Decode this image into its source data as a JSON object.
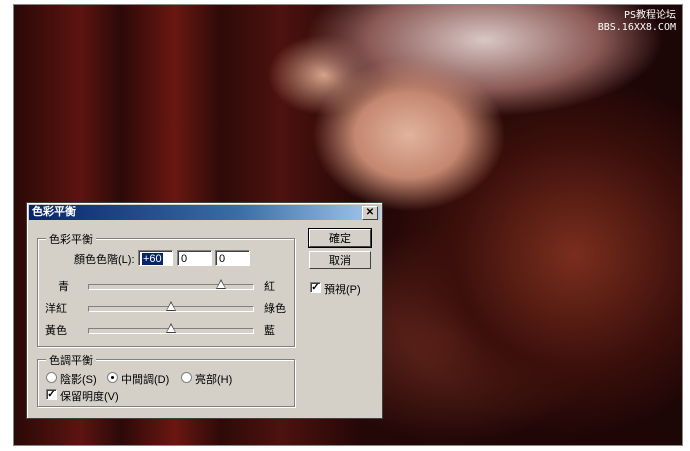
{
  "watermark": {
    "line1": "PS教程论坛",
    "line2": "BBS.16XX8.COM"
  },
  "dialog": {
    "title": "色彩平衡",
    "close_glyph": "✕",
    "color_balance": {
      "group_title": "色彩平衡",
      "levels_label": "顏色色階(L):",
      "levels": [
        "+60",
        "0",
        "0"
      ],
      "sliders": [
        {
          "left": "青",
          "right": "紅",
          "value": 60
        },
        {
          "left": "洋紅",
          "right": "綠色",
          "value": 0
        },
        {
          "left": "黃色",
          "right": "藍",
          "value": 0
        }
      ]
    },
    "tone_balance": {
      "group_title": "色調平衡",
      "options": [
        {
          "label": "陰影(S)",
          "checked": false
        },
        {
          "label": "中間調(D)",
          "checked": true
        },
        {
          "label": "亮部(H)",
          "checked": false
        }
      ],
      "preserve_label": "保留明度(V)",
      "preserve_checked": true
    },
    "buttons": {
      "ok": "確定",
      "cancel": "取消"
    },
    "preview_label": "預視(P)",
    "preview_checked": true
  }
}
